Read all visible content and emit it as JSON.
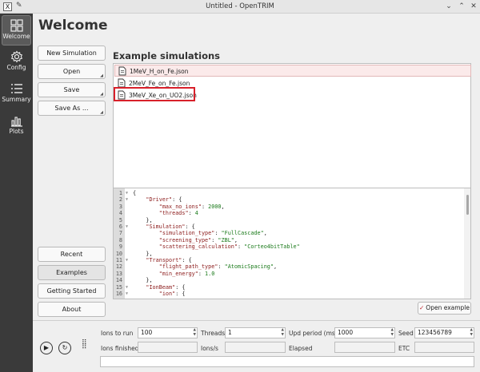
{
  "window": {
    "title": "Untitled - OpenTRIM",
    "app_icon": "X"
  },
  "sidebar": {
    "items": [
      {
        "label": "Welcome",
        "icon": "grid-icon"
      },
      {
        "label": "Config",
        "icon": "gear-icon"
      },
      {
        "label": "Summary",
        "icon": "list-icon"
      },
      {
        "label": "Plots",
        "icon": "bar-chart-icon"
      }
    ]
  },
  "page": {
    "title": "Welcome"
  },
  "left_buttons": {
    "new_simulation": "New Simulation",
    "open": "Open",
    "save": "Save",
    "save_as": "Save As ...",
    "recent": "Recent",
    "examples": "Examples",
    "getting_started": "Getting Started",
    "about": "About"
  },
  "examples": {
    "title": "Example simulations",
    "items": [
      "1MeV_H_on_Fe.json",
      "2MeV_Fe_on_Fe.json",
      "3MeV_Xe_on_UO2.json"
    ],
    "open_button": "Open example"
  },
  "editor": {
    "lines": [
      {
        "n": "1",
        "text": "{"
      },
      {
        "n": "2",
        "text": "    \"Driver\": {"
      },
      {
        "n": "3",
        "text": "        \"max_no_ions\": 2000,"
      },
      {
        "n": "4",
        "text": "        \"threads\": 4"
      },
      {
        "n": "5",
        "text": "    },"
      },
      {
        "n": "6",
        "text": "    \"Simulation\": {"
      },
      {
        "n": "7",
        "text": "        \"simulation_type\": \"FullCascade\","
      },
      {
        "n": "8",
        "text": "        \"screening_type\": \"ZBL\","
      },
      {
        "n": "9",
        "text": "        \"scattering_calculation\": \"Corteo4bitTable\""
      },
      {
        "n": "10",
        "text": "    },"
      },
      {
        "n": "11",
        "text": "    \"Transport\": {"
      },
      {
        "n": "12",
        "text": "        \"flight_path_type\": \"AtomicSpacing\","
      },
      {
        "n": "13",
        "text": "        \"min_energy\": 1.0"
      },
      {
        "n": "14",
        "text": "    },"
      },
      {
        "n": "15",
        "text": "    \"IonBeam\": {"
      },
      {
        "n": "16",
        "text": "        \"ion\": {"
      }
    ]
  },
  "run": {
    "ions_to_run_label": "Ions to run",
    "ions_to_run_value": "100",
    "threads_label": "Threads",
    "threads_value": "1",
    "upd_period_label": "Upd period (ms)",
    "upd_period_value": "1000",
    "seed_label": "Seed",
    "seed_value": "123456789",
    "ions_finished_label": "Ions finished",
    "ions_per_s_label": "Ions/s",
    "elapsed_label": "Elapsed",
    "etc_label": "ETC"
  },
  "colors": {
    "sidebar_bg": "#3a3a3a",
    "highlight_red": "#d8202a",
    "selected_row": "#fbeaea"
  }
}
